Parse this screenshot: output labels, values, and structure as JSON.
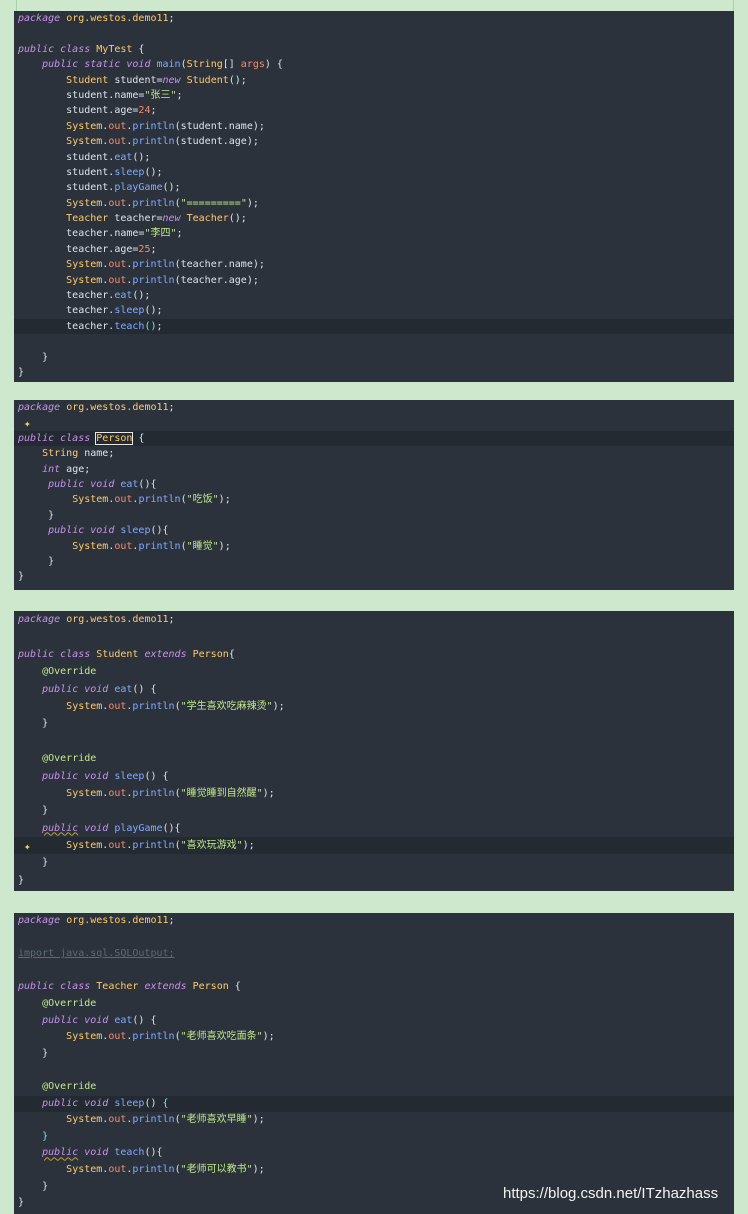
{
  "panels": [
    {
      "name": "MyTest",
      "lines": [
        [
          [
            "kw2",
            "package"
          ],
          [
            "plain",
            " "
          ],
          [
            "pkg",
            "org.westos.demo11"
          ],
          [
            "plain",
            ";"
          ]
        ],
        [],
        [
          [
            "kw2",
            "public class "
          ],
          [
            "typ",
            "MyTest"
          ],
          [
            "plain",
            " {"
          ]
        ],
        [
          [
            "plain",
            "    "
          ],
          [
            "kw2",
            "public static void "
          ],
          [
            "mth",
            "main"
          ],
          [
            "plain",
            "("
          ],
          [
            "typ",
            "String"
          ],
          [
            "plain",
            "[] "
          ],
          [
            "fld",
            "args"
          ],
          [
            "plain",
            ") {"
          ]
        ],
        [
          [
            "plain",
            "        "
          ],
          [
            "typ",
            "Student"
          ],
          [
            "plain",
            " student="
          ],
          [
            "kw2",
            "new "
          ],
          [
            "typ",
            "Student"
          ],
          [
            "plain",
            "();"
          ]
        ],
        [
          [
            "plain",
            "        student."
          ],
          [
            "plain",
            "name"
          ],
          [
            "plain",
            "="
          ],
          [
            "str",
            "\"张三\""
          ],
          [
            "plain",
            ";"
          ]
        ],
        [
          [
            "plain",
            "        student."
          ],
          [
            "plain",
            "age"
          ],
          [
            "plain",
            "="
          ],
          [
            "num",
            "24"
          ],
          [
            "plain",
            ";"
          ]
        ],
        [
          [
            "plain",
            "        "
          ],
          [
            "typ",
            "System"
          ],
          [
            "plain",
            "."
          ],
          [
            "fld",
            "out"
          ],
          [
            "plain",
            "."
          ],
          [
            "mth",
            "println"
          ],
          [
            "plain",
            "(student.name);"
          ]
        ],
        [
          [
            "plain",
            "        "
          ],
          [
            "typ",
            "System"
          ],
          [
            "plain",
            "."
          ],
          [
            "fld",
            "out"
          ],
          [
            "plain",
            "."
          ],
          [
            "mth",
            "println"
          ],
          [
            "plain",
            "(student.age);"
          ]
        ],
        [
          [
            "plain",
            "        student."
          ],
          [
            "mth",
            "eat"
          ],
          [
            "plain",
            "();"
          ]
        ],
        [
          [
            "plain",
            "        student."
          ],
          [
            "mth",
            "sleep"
          ],
          [
            "plain",
            "();"
          ]
        ],
        [
          [
            "plain",
            "        student."
          ],
          [
            "mth",
            "playGame"
          ],
          [
            "plain",
            "();"
          ]
        ],
        [
          [
            "plain",
            "        "
          ],
          [
            "typ",
            "System"
          ],
          [
            "plain",
            "."
          ],
          [
            "fld",
            "out"
          ],
          [
            "plain",
            "."
          ],
          [
            "mth",
            "println"
          ],
          [
            "plain",
            "("
          ],
          [
            "str",
            "\"=========\""
          ],
          [
            "plain",
            ");"
          ]
        ],
        [
          [
            "plain",
            "        "
          ],
          [
            "typ",
            "Teacher"
          ],
          [
            "plain",
            " teacher="
          ],
          [
            "kw2",
            "new "
          ],
          [
            "typ",
            "Teacher"
          ],
          [
            "plain",
            "();"
          ]
        ],
        [
          [
            "plain",
            "        teacher.name="
          ],
          [
            "str",
            "\"李四\""
          ],
          [
            "plain",
            ";"
          ]
        ],
        [
          [
            "plain",
            "        teacher.age="
          ],
          [
            "num",
            "25"
          ],
          [
            "plain",
            ";"
          ]
        ],
        [
          [
            "plain",
            "        "
          ],
          [
            "typ",
            "System"
          ],
          [
            "plain",
            "."
          ],
          [
            "fld",
            "out"
          ],
          [
            "plain",
            "."
          ],
          [
            "mth",
            "println"
          ],
          [
            "plain",
            "(teacher.name);"
          ]
        ],
        [
          [
            "plain",
            "        "
          ],
          [
            "typ",
            "System"
          ],
          [
            "plain",
            "."
          ],
          [
            "fld",
            "out"
          ],
          [
            "plain",
            "."
          ],
          [
            "mth",
            "println"
          ],
          [
            "plain",
            "(teacher.age);"
          ]
        ],
        [
          [
            "plain",
            "        teacher."
          ],
          [
            "mth",
            "eat"
          ],
          [
            "plain",
            "();"
          ]
        ],
        [
          [
            "plain",
            "        teacher."
          ],
          [
            "mth",
            "sleep"
          ],
          [
            "plain",
            "();"
          ]
        ],
        [
          [
            "plain",
            "        teacher."
          ],
          [
            "mth",
            "teach"
          ],
          [
            "brace",
            "()"
          ],
          [
            "plain",
            ";"
          ]
        ],
        [],
        [
          [
            "plain",
            "    }"
          ]
        ],
        [
          [
            "plain",
            "}"
          ]
        ]
      ],
      "highlight": [
        20
      ]
    },
    {
      "name": "Person",
      "lines": [
        [
          [
            "kw2",
            "package"
          ],
          [
            "plain",
            " "
          ],
          [
            "pkg",
            "org.westos.demo11"
          ],
          [
            "plain",
            ";"
          ]
        ],
        [],
        [
          [
            "kw2",
            "public class "
          ],
          [
            "typ",
            "Person"
          ],
          [
            "plain",
            " {"
          ]
        ],
        [
          [
            "plain",
            "    "
          ],
          [
            "typ",
            "String"
          ],
          [
            "plain",
            " name;"
          ]
        ],
        [
          [
            "plain",
            "    "
          ],
          [
            "kw2",
            "int"
          ],
          [
            "plain",
            " age;"
          ]
        ],
        [
          [
            "plain",
            "     "
          ],
          [
            "kw2",
            "public void "
          ],
          [
            "mth",
            "eat"
          ],
          [
            "plain",
            "(){"
          ]
        ],
        [
          [
            "plain",
            "         "
          ],
          [
            "typ",
            "System"
          ],
          [
            "plain",
            "."
          ],
          [
            "fld",
            "out"
          ],
          [
            "plain",
            "."
          ],
          [
            "mth",
            "println"
          ],
          [
            "plain",
            "("
          ],
          [
            "str",
            "\"吃饭\""
          ],
          [
            "plain",
            ");"
          ]
        ],
        [
          [
            "plain",
            "     }"
          ]
        ],
        [
          [
            "plain",
            "     "
          ],
          [
            "kw2",
            "public void "
          ],
          [
            "mth",
            "sleep"
          ],
          [
            "plain",
            "(){"
          ]
        ],
        [
          [
            "plain",
            "         "
          ],
          [
            "typ",
            "System"
          ],
          [
            "plain",
            "."
          ],
          [
            "fld",
            "out"
          ],
          [
            "plain",
            "."
          ],
          [
            "mth",
            "println"
          ],
          [
            "plain",
            "("
          ],
          [
            "str",
            "\"睡觉\""
          ],
          [
            "plain",
            ");"
          ]
        ],
        [
          [
            "plain",
            "     }"
          ]
        ],
        [
          [
            "plain",
            "}"
          ]
        ]
      ],
      "highlight": [
        2
      ]
    },
    {
      "name": "Student",
      "lines": [
        [
          [
            "kw2",
            "package"
          ],
          [
            "plain",
            " "
          ],
          [
            "pkg",
            "org.westos.demo11"
          ],
          [
            "plain",
            ";"
          ]
        ],
        [],
        [
          [
            "kw2",
            "public class "
          ],
          [
            "typ",
            "Student"
          ],
          [
            "kw2",
            " extends "
          ],
          [
            "typ",
            "Person"
          ],
          [
            "plain",
            "{"
          ]
        ],
        [
          [
            "plain",
            "    "
          ],
          [
            "ann",
            "@Override"
          ]
        ],
        [
          [
            "plain",
            "    "
          ],
          [
            "kw2",
            "public void "
          ],
          [
            "mth",
            "eat"
          ],
          [
            "plain",
            "() {"
          ]
        ],
        [
          [
            "plain",
            "        "
          ],
          [
            "typ",
            "System"
          ],
          [
            "plain",
            "."
          ],
          [
            "fld",
            "out"
          ],
          [
            "plain",
            "."
          ],
          [
            "mth",
            "println"
          ],
          [
            "plain",
            "("
          ],
          [
            "str",
            "\"学生喜欢吃麻辣烫\""
          ],
          [
            "plain",
            ");"
          ]
        ],
        [
          [
            "plain",
            "    }"
          ]
        ],
        [],
        [
          [
            "plain",
            "    "
          ],
          [
            "ann",
            "@Override"
          ]
        ],
        [
          [
            "plain",
            "    "
          ],
          [
            "kw2",
            "public void "
          ],
          [
            "mth",
            "sleep"
          ],
          [
            "plain",
            "() {"
          ]
        ],
        [
          [
            "plain",
            "        "
          ],
          [
            "typ",
            "System"
          ],
          [
            "plain",
            "."
          ],
          [
            "fld",
            "out"
          ],
          [
            "plain",
            "."
          ],
          [
            "mth",
            "println"
          ],
          [
            "plain",
            "("
          ],
          [
            "str",
            "\"睡觉睡到自然醒\""
          ],
          [
            "plain",
            ");"
          ]
        ],
        [
          [
            "plain",
            "    }"
          ]
        ],
        [
          [
            "plain",
            "    "
          ],
          [
            "kw2",
            "public"
          ],
          [
            "kw2",
            " void "
          ],
          [
            "mth",
            "playGame"
          ],
          [
            "plain",
            "(){"
          ]
        ],
        [
          [
            "plain",
            "        "
          ],
          [
            "typ",
            "System"
          ],
          [
            "plain",
            "."
          ],
          [
            "fld",
            "out"
          ],
          [
            "plain",
            "."
          ],
          [
            "mth",
            "println"
          ],
          [
            "plain",
            "("
          ],
          [
            "str",
            "\"喜欢玩游戏\""
          ],
          [
            "plain",
            ");"
          ]
        ],
        [
          [
            "plain",
            "    }"
          ]
        ],
        [
          [
            "plain",
            "}"
          ]
        ]
      ],
      "highlight": [
        13
      ]
    },
    {
      "name": "Teacher",
      "lines": [
        [
          [
            "kw2",
            "package"
          ],
          [
            "plain",
            " "
          ],
          [
            "pkg",
            "org.westos.demo11"
          ],
          [
            "plain",
            ";"
          ]
        ],
        [],
        [
          [
            "dim",
            "import java.sql.SQLOutput;"
          ]
        ],
        [],
        [
          [
            "kw2",
            "public class "
          ],
          [
            "typ",
            "Teacher"
          ],
          [
            "kw2",
            " extends "
          ],
          [
            "typ",
            "Person"
          ],
          [
            "plain",
            " {"
          ]
        ],
        [
          [
            "plain",
            "    "
          ],
          [
            "ann",
            "@Override"
          ]
        ],
        [
          [
            "plain",
            "    "
          ],
          [
            "kw2",
            "public void "
          ],
          [
            "mth",
            "eat"
          ],
          [
            "plain",
            "() {"
          ]
        ],
        [
          [
            "plain",
            "        "
          ],
          [
            "typ",
            "System"
          ],
          [
            "plain",
            "."
          ],
          [
            "fld",
            "out"
          ],
          [
            "plain",
            "."
          ],
          [
            "mth",
            "println"
          ],
          [
            "plain",
            "("
          ],
          [
            "str",
            "\"老师喜欢吃面条\""
          ],
          [
            "plain",
            ");"
          ]
        ],
        [
          [
            "plain",
            "    }"
          ]
        ],
        [],
        [
          [
            "plain",
            "    "
          ],
          [
            "ann",
            "@Override"
          ]
        ],
        [
          [
            "plain",
            "    "
          ],
          [
            "kw2",
            "public void "
          ],
          [
            "mth",
            "sleep"
          ],
          [
            "plain",
            "() "
          ],
          [
            "brace",
            "{"
          ]
        ],
        [
          [
            "plain",
            "        "
          ],
          [
            "typ",
            "System"
          ],
          [
            "plain",
            "."
          ],
          [
            "fld",
            "out"
          ],
          [
            "plain",
            "."
          ],
          [
            "mth",
            "println"
          ],
          [
            "plain",
            "("
          ],
          [
            "str",
            "\"老师喜欢早睡\""
          ],
          [
            "plain",
            ");"
          ]
        ],
        [
          [
            "plain",
            "    "
          ],
          [
            "brace",
            "}"
          ]
        ],
        [
          [
            "plain",
            "    "
          ],
          [
            "kw2",
            "public"
          ],
          [
            "kw2",
            " void "
          ],
          [
            "mth",
            "teach"
          ],
          [
            "plain",
            "(){"
          ]
        ],
        [
          [
            "plain",
            "        "
          ],
          [
            "typ",
            "System"
          ],
          [
            "plain",
            "."
          ],
          [
            "fld",
            "out"
          ],
          [
            "plain",
            "."
          ],
          [
            "mth",
            "println"
          ],
          [
            "plain",
            "("
          ],
          [
            "str",
            "\"老师可以教书\""
          ],
          [
            "plain",
            ");"
          ]
        ],
        [
          [
            "plain",
            "    }"
          ]
        ],
        [
          [
            "plain",
            "}"
          ]
        ]
      ],
      "highlight": [
        11
      ]
    }
  ],
  "icons": {
    "bulb": "lightbulb-icon"
  },
  "watermark": "https://blog.csdn.net/ITzhazhass"
}
